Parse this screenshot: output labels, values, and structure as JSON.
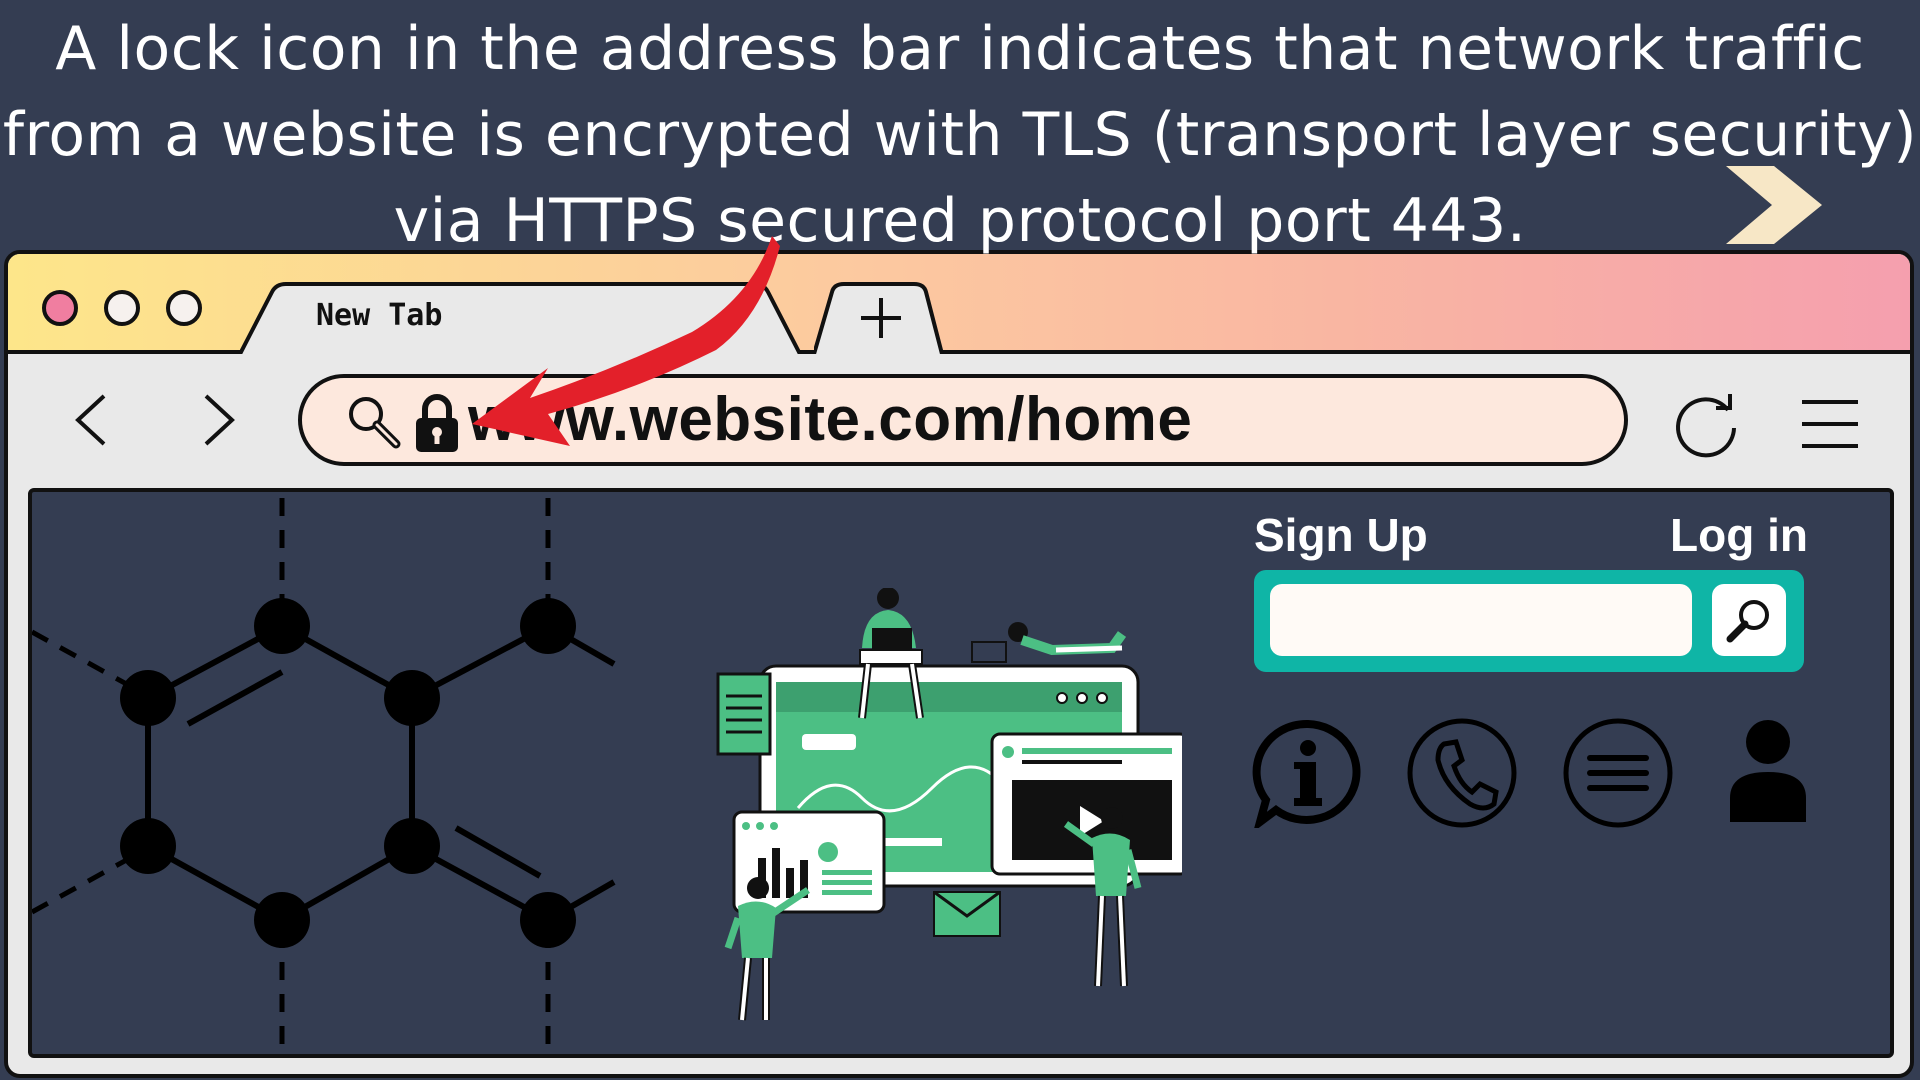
{
  "caption": {
    "line1": "A lock icon in the address bar indicates that network traffic",
    "line2": "from a website is encrypted with TLS (transport layer security)",
    "line3": "via HTTPS secured protocol port 443."
  },
  "browser": {
    "tab": {
      "title": "New Tab"
    },
    "address_bar": {
      "url": "www.website.com/home"
    },
    "icons": [
      "search-icon",
      "lock-icon",
      "back-icon",
      "forward-icon",
      "reload-icon",
      "hamburger-menu-icon",
      "plus-icon"
    ]
  },
  "website": {
    "sign_up_label": "Sign Up",
    "log_in_label": "Log in",
    "search_placeholder": "",
    "icons": [
      "info-icon",
      "phone-icon",
      "menu-icon",
      "user-icon"
    ]
  },
  "colors": {
    "page_background": "#343d52",
    "accent_teal": "#0fb5a6",
    "illustration_green": "#4cbf84",
    "arrow_red": "#e3202a",
    "close_dot": "#f07ea0",
    "address_bar_fill": "#fde8dd"
  }
}
